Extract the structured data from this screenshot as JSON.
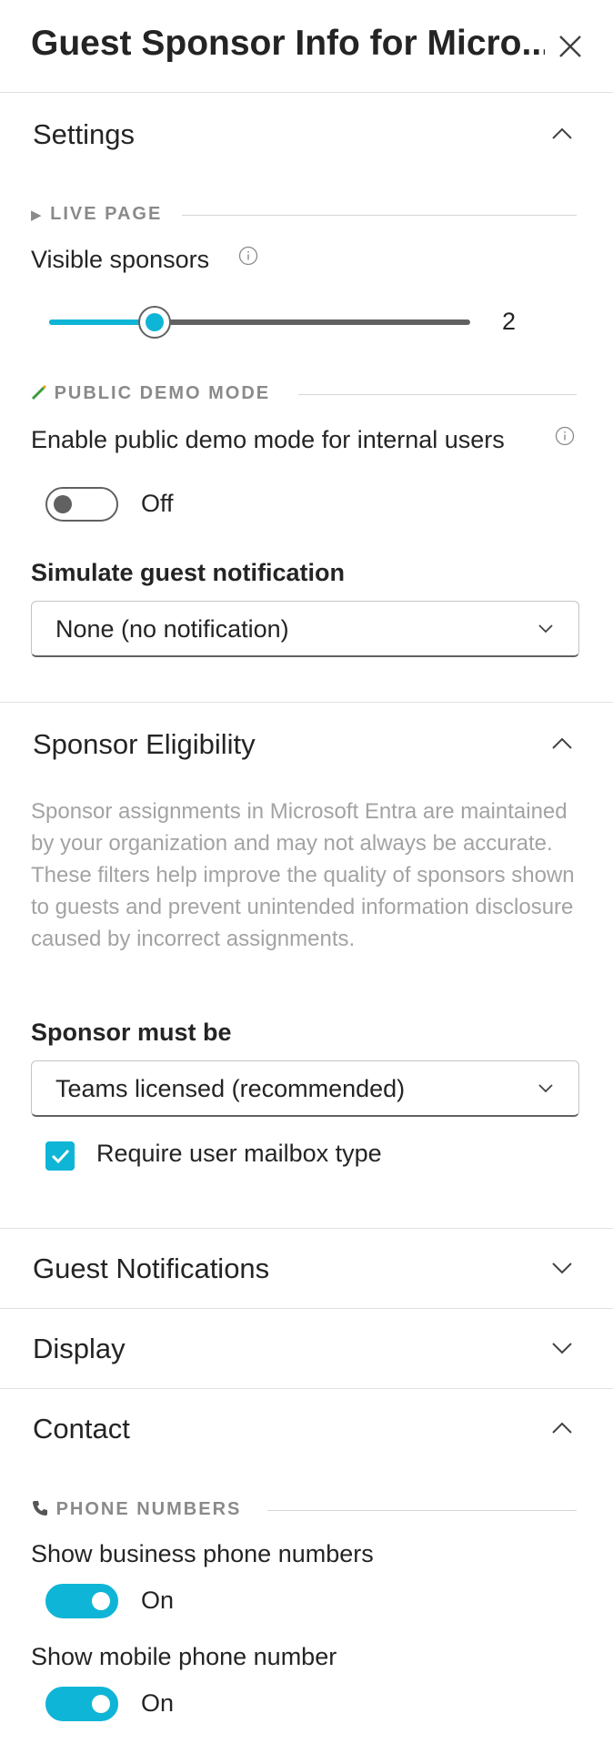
{
  "header": {
    "title": "Guest Sponsor Info for Micro..."
  },
  "settings": {
    "title": "Settings",
    "live_page_label": "LIVE PAGE",
    "visible_sponsors_label": "Visible sponsors",
    "visible_sponsors_value": "2",
    "visible_sponsors_fraction": 0.25,
    "demo_mode_label": "PUBLIC DEMO MODE",
    "enable_demo_label": "Enable public demo mode for internal users",
    "demo_toggle_state": "Off",
    "simulate_label": "Simulate guest notification",
    "simulate_value": "None (no notification)"
  },
  "eligibility": {
    "title": "Sponsor Eligibility",
    "description": "Sponsor assignments in Microsoft Entra are maintained by your organization and may not always be accurate. These filters help improve the quality of sponsors shown to guests and prevent unintended information disclosure caused by incorrect assignments.",
    "must_be_label": "Sponsor must be",
    "must_be_value": "Teams licensed (recommended)",
    "mailbox_label": "Require user mailbox type"
  },
  "guest_notifications": {
    "title": "Guest Notifications"
  },
  "display": {
    "title": "Display"
  },
  "contact": {
    "title": "Contact",
    "phone_label": "PHONE NUMBERS",
    "business_label": "Show business phone numbers",
    "business_state": "On",
    "mobile_label": "Show mobile phone number",
    "mobile_state": "On"
  },
  "colors": {
    "accent": "#0fb5d6",
    "text": "#242424",
    "muted": "#a3a3a3"
  }
}
